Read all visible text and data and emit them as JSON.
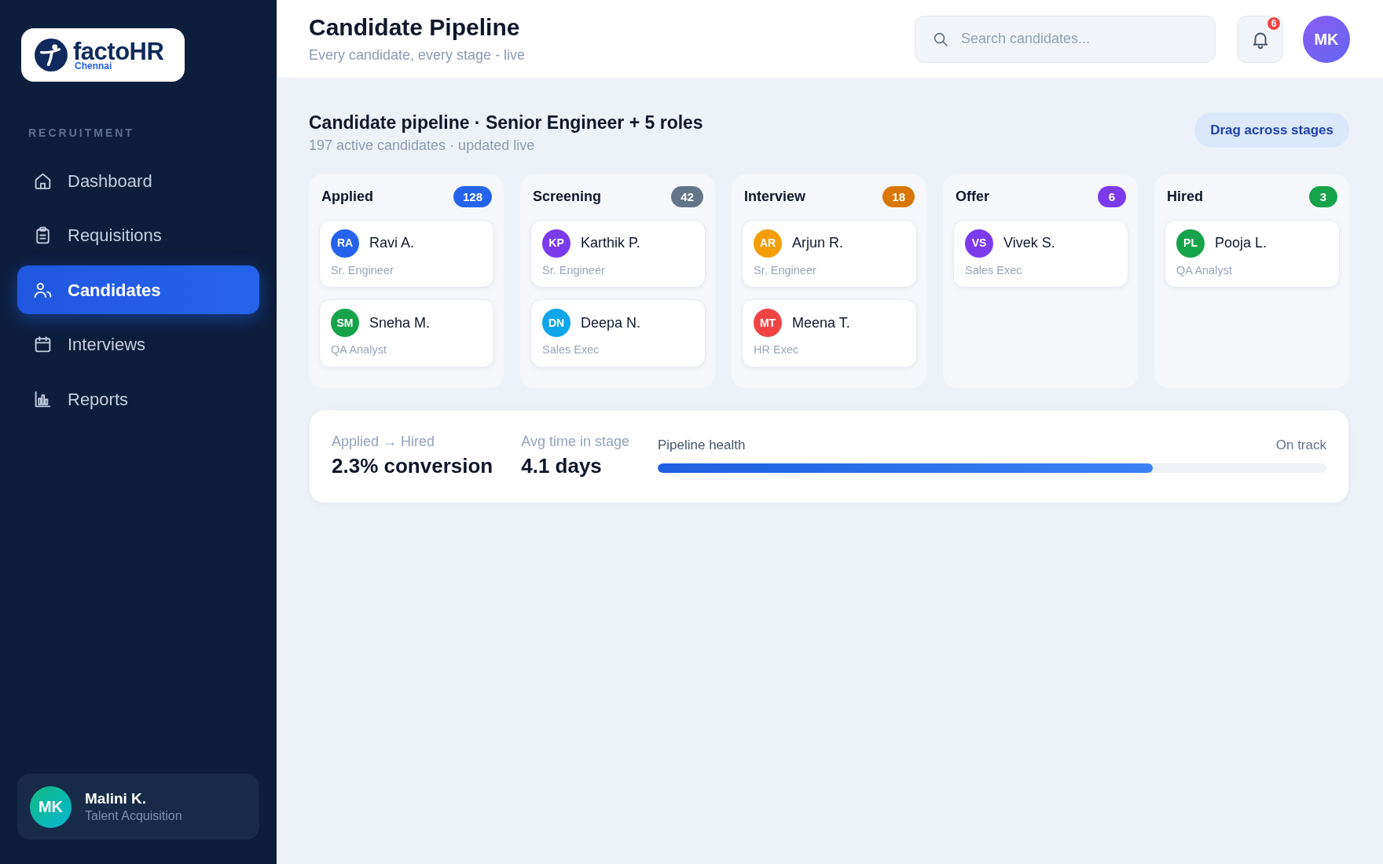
{
  "sidebar": {
    "logo": {
      "name": "factoHR",
      "location": "Chennai"
    },
    "section_label": "RECRUITMENT",
    "items": [
      {
        "label": "Dashboard",
        "selected": false
      },
      {
        "label": "Requisitions",
        "selected": false
      },
      {
        "label": "Candidates",
        "selected": true
      },
      {
        "label": "Interviews",
        "selected": false
      },
      {
        "label": "Reports",
        "selected": false
      }
    ],
    "user": {
      "initials": "MK",
      "name": "Malini K.",
      "role": "Talent Acquisition"
    }
  },
  "header": {
    "title": "Candidate Pipeline",
    "subtitle": "Every candidate, every stage - live",
    "search": {
      "placeholder": "Search candidates..."
    },
    "notifications": {
      "count": "6"
    },
    "avatar": {
      "initials": "MK"
    }
  },
  "pipeline": {
    "title": "Candidate pipeline · Senior Engineer + 5 roles",
    "subtitle": "197 active candidates · updated live",
    "action": "Drag across stages",
    "stages": [
      {
        "name": "Applied",
        "count": "128",
        "color": "#2563eb",
        "candidates": [
          {
            "initials": "RA",
            "name": "Ravi A.",
            "role": "Sr. Engineer",
            "color": "#2563eb"
          },
          {
            "initials": "SM",
            "name": "Sneha M.",
            "role": "QA Analyst",
            "color": "#16a34a"
          }
        ]
      },
      {
        "name": "Screening",
        "count": "42",
        "color": "#64748b",
        "candidates": [
          {
            "initials": "KP",
            "name": "Karthik P.",
            "role": "Sr. Engineer",
            "color": "#7c3aed"
          },
          {
            "initials": "DN",
            "name": "Deepa N.",
            "role": "Sales Exec",
            "color": "#0ea5e9"
          }
        ]
      },
      {
        "name": "Interview",
        "count": "18",
        "color": "#d97706",
        "candidates": [
          {
            "initials": "AR",
            "name": "Arjun R.",
            "role": "Sr. Engineer",
            "color": "#f59e0b"
          },
          {
            "initials": "MT",
            "name": "Meena T.",
            "role": "HR Exec",
            "color": "#ef4444"
          }
        ]
      },
      {
        "name": "Offer",
        "count": "6",
        "color": "#7c3aed",
        "candidates": [
          {
            "initials": "VS",
            "name": "Vivek S.",
            "role": "Sales Exec",
            "color": "#7c3aed"
          }
        ]
      },
      {
        "name": "Hired",
        "count": "3",
        "color": "#16a34a",
        "candidates": [
          {
            "initials": "PL",
            "name": "Pooja L.",
            "role": "QA Analyst",
            "color": "#16a34a"
          }
        ]
      }
    ]
  },
  "summary": {
    "stats": [
      {
        "label": "Applied → Hired",
        "value": "2.3% conversion"
      },
      {
        "label": "Avg time in stage",
        "value": "4.1 days"
      }
    ],
    "health": {
      "label": "Pipeline health",
      "status": "On track",
      "level": 0.74
    }
  }
}
